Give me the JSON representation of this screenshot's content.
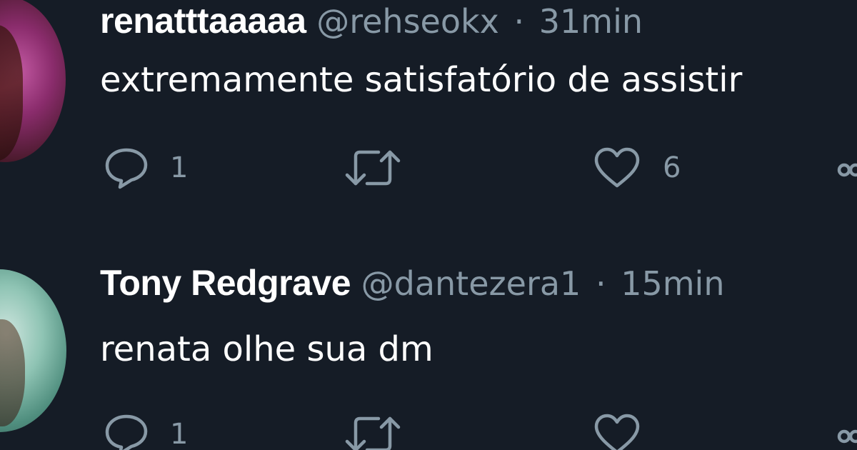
{
  "tweets": [
    {
      "display_name": "renatttaaaaa",
      "handle": "@rehseokx",
      "separator": "·",
      "time": "31min",
      "text": "extremamente satisfatório de assistir",
      "reply_count": "1",
      "retweet_count": "",
      "like_count": "6",
      "avatar_colors": [
        "#c45aa4",
        "#4a1a2c"
      ]
    },
    {
      "display_name": "Tony Redgrave",
      "handle": "@dantezera1",
      "separator": "·",
      "time": "15min",
      "text": "renata olhe sua dm",
      "reply_count": "1",
      "retweet_count": "",
      "like_count": "",
      "avatar_colors": [
        "#cfe6df",
        "#4f8e7e"
      ]
    }
  ],
  "icons": {
    "reply": "reply-icon",
    "retweet": "retweet-icon",
    "like": "heart-icon",
    "share": "share-icon"
  },
  "theme": {
    "background": "#151c26",
    "primary_text": "#ffffff",
    "secondary_text": "#8899a6"
  }
}
